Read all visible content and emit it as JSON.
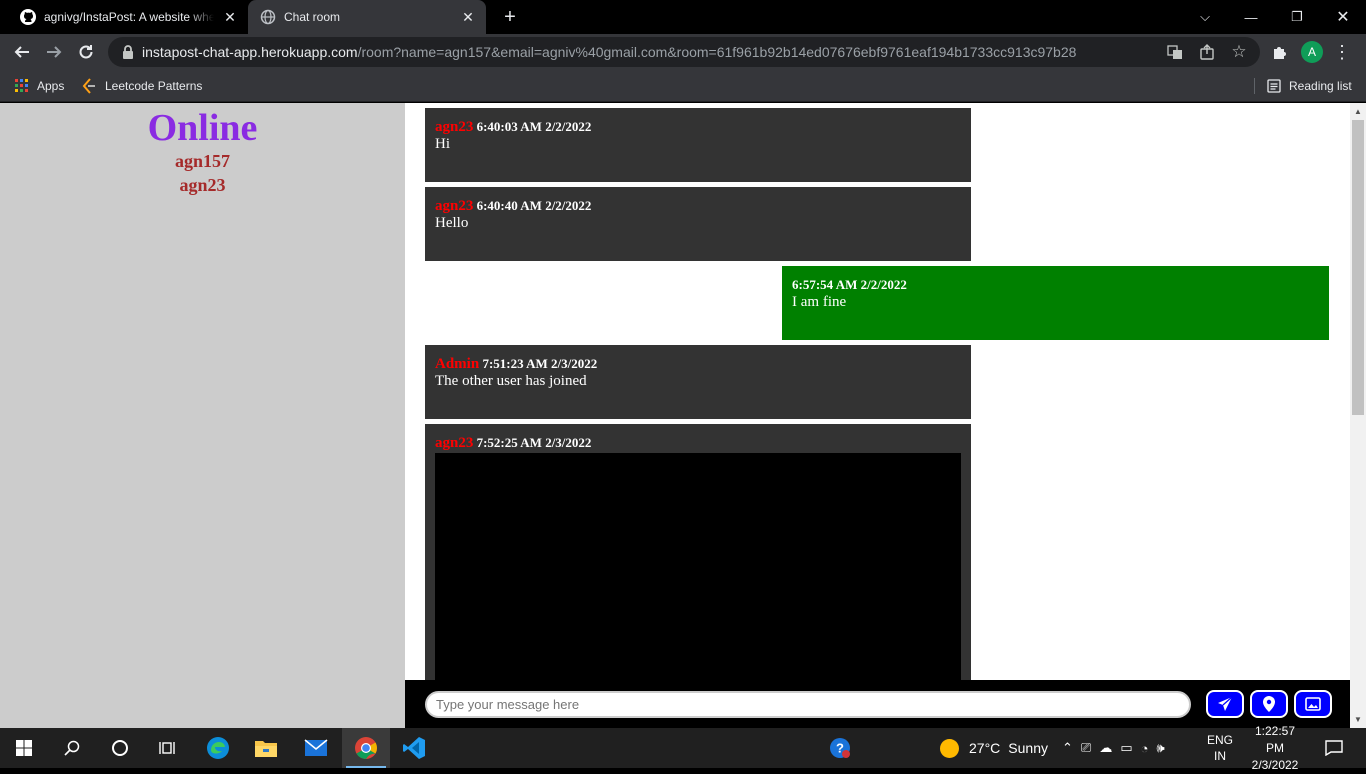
{
  "browser": {
    "tabs": [
      {
        "title": "agnivg/InstaPost: A website where",
        "icon": "github-icon"
      },
      {
        "title": "Chat room",
        "icon": "globe-icon"
      }
    ],
    "url_host": "instapost-chat-app.herokuapp.com",
    "url_path": "/room?name=agn157&email=agniv%40gmail.com&room=61f961b92b14ed07676ebf9761eaf194b1733cc913c97b28",
    "profile_initial": "A",
    "bookmarks": [
      {
        "label": "Apps",
        "icon": "apps-grid-icon"
      },
      {
        "label": "Leetcode Patterns",
        "icon": "leetcode-icon"
      }
    ],
    "reading_list": "Reading list"
  },
  "sidebar": {
    "title": "Online",
    "users": [
      "agn157",
      "agn23"
    ]
  },
  "messages": [
    {
      "author": "agn23",
      "time": "6:40:03 AM 2/2/2022",
      "text": "Hi",
      "self": false
    },
    {
      "author": "agn23",
      "time": "6:40:40 AM 2/2/2022",
      "text": "Hello",
      "self": false
    },
    {
      "author": "",
      "time": "6:57:54 AM 2/2/2022",
      "text": "I am fine",
      "self": true
    },
    {
      "author": "Admin",
      "time": "7:51:23 AM 2/3/2022",
      "text": "The other user has joined",
      "self": false
    },
    {
      "author": "agn23",
      "time": "7:52:25 AM 2/3/2022",
      "text": "",
      "self": false
    }
  ],
  "composer": {
    "placeholder": "Type your message here"
  },
  "taskbar": {
    "weather_temp": "27°C",
    "weather_desc": "Sunny",
    "lang_top": "ENG",
    "lang_bottom": "IN",
    "time": "1:22:57 PM",
    "date": "2/3/2022"
  },
  "colors": {
    "online_title": "#8a2be2",
    "online_user": "#a52a2a",
    "author": "#ff0000",
    "self_bubble": "#008000",
    "other_bubble": "#333333",
    "action_button": "#0000ff"
  }
}
